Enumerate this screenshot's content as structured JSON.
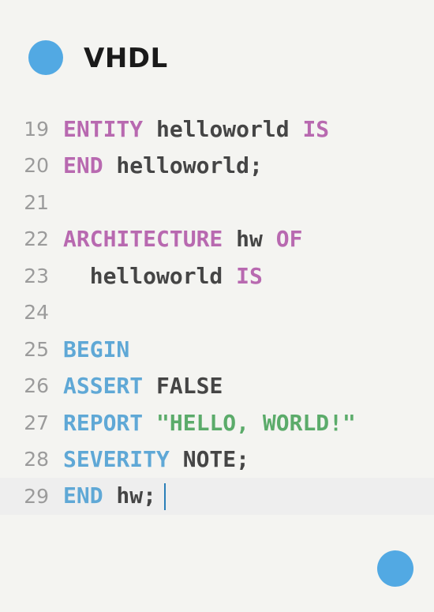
{
  "title": "VHDL",
  "colors": {
    "accent": "#52a9e3",
    "purple": "#b869b0",
    "blue": "#5fa8d6",
    "blue_dark": "#2a7fb8",
    "green": "#5bab6a"
  },
  "lines": [
    {
      "num": "19",
      "tokens": [
        {
          "t": "ENTITY",
          "c": "kw-purple"
        },
        {
          "t": " helloworld ",
          "c": "plain"
        },
        {
          "t": "IS",
          "c": "kw-purple"
        }
      ]
    },
    {
      "num": "20",
      "tokens": [
        {
          "t": "END",
          "c": "kw-purple"
        },
        {
          "t": " helloworld;",
          "c": "plain"
        }
      ]
    },
    {
      "num": "21",
      "tokens": []
    },
    {
      "num": "22",
      "tokens": [
        {
          "t": "ARCHITECTURE",
          "c": "kw-purple"
        },
        {
          "t": " hw ",
          "c": "plain"
        },
        {
          "t": "OF",
          "c": "kw-purple"
        }
      ]
    },
    {
      "num": "23",
      "tokens": [
        {
          "t": "  helloworld ",
          "c": "plain"
        },
        {
          "t": "IS",
          "c": "kw-purple"
        }
      ]
    },
    {
      "num": "24",
      "tokens": []
    },
    {
      "num": "25",
      "tokens": [
        {
          "t": "BEGIN",
          "c": "kw-blue"
        }
      ]
    },
    {
      "num": "26",
      "tokens": [
        {
          "t": "ASSERT",
          "c": "kw-blue"
        },
        {
          "t": " FALSE",
          "c": "plain"
        }
      ]
    },
    {
      "num": "27",
      "tokens": [
        {
          "t": "REPORT",
          "c": "kw-blue"
        },
        {
          "t": " ",
          "c": "plain"
        },
        {
          "t": "\"HELLO, WORLD!\"",
          "c": "str-green"
        }
      ]
    },
    {
      "num": "28",
      "tokens": [
        {
          "t": "SEVERITY",
          "c": "kw-blue"
        },
        {
          "t": " NOTE;",
          "c": "plain"
        }
      ]
    },
    {
      "num": "29",
      "tokens": [
        {
          "t": "END",
          "c": "kw-blue"
        },
        {
          "t": " hw;",
          "c": "plain"
        }
      ],
      "active": true,
      "cursor": true
    }
  ]
}
